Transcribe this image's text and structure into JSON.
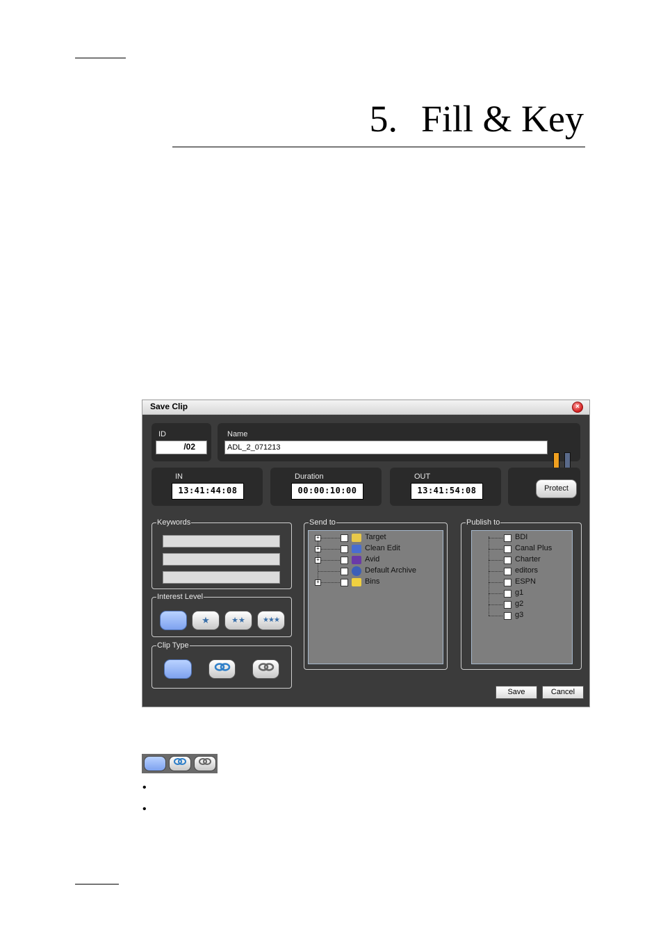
{
  "document": {
    "chapter_number": "5.",
    "chapter_title": "Fill & Key",
    "bullets": [
      "•",
      "•"
    ]
  },
  "dialog": {
    "title": "Save Clip",
    "close_icon": "close-icon",
    "id_label": "ID",
    "id_value": "/02",
    "name_label": "Name",
    "name_value": "ADL_2_071213",
    "in_label": "IN",
    "in_value": "13:41:44:08",
    "duration_label": "Duration",
    "duration_value": "00:00:10:00",
    "out_label": "OUT",
    "out_value": "13:41:54:08",
    "protect_label": "Protect",
    "keywords_label": "Keywords",
    "interest_label": "Interest Level",
    "interest_icons": [
      "none",
      "★",
      "★★",
      "★★★"
    ],
    "clip_type_label": "Clip Type",
    "clip_type_icons": [
      "blank",
      "link-icon",
      "link-grey-icon"
    ],
    "send_to_label": "Send to",
    "send_to_items": [
      {
        "label": "Target",
        "icon": "folder-icon",
        "color": "#e8c84a"
      },
      {
        "label": "Clean Edit",
        "icon": "clean-edit-icon",
        "color": "#4a6ed0"
      },
      {
        "label": "Avid",
        "icon": "avid-icon",
        "color": "#6a3aa8"
      },
      {
        "label": "Default Archive",
        "icon": "archive-icon",
        "color": "#3d5fb8"
      },
      {
        "label": "Bins",
        "icon": "bin-icon",
        "color": "#f0d040"
      }
    ],
    "publish_to_label": "Publish to",
    "publish_to_items": [
      "BDI",
      "Canal Plus",
      "Charter",
      "editors",
      "ESPN",
      "g1",
      "g2",
      "g3"
    ],
    "save_label": "Save",
    "cancel_label": "Cancel",
    "meter_colors": [
      "#f0a020",
      "#5a6a8a"
    ]
  },
  "strip": {
    "icons": [
      "blank",
      "link-icon",
      "link-grey-icon"
    ]
  }
}
